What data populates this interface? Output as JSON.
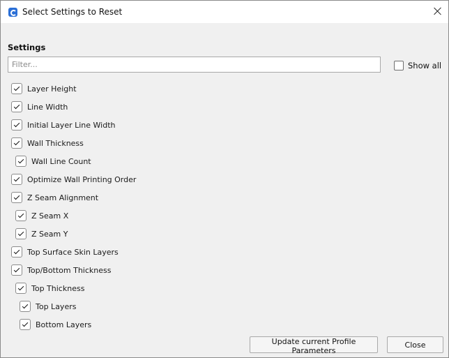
{
  "window": {
    "title": "Select Settings to Reset"
  },
  "settings_label": "Settings",
  "filter": {
    "placeholder": "Filter...",
    "value": ""
  },
  "show_all": {
    "label": "Show all",
    "checked": false
  },
  "settings": [
    {
      "label": "Layer Height",
      "checked": true
    },
    {
      "label": "Line Width",
      "checked": true
    },
    {
      "label": "Initial Layer Line Width",
      "checked": true
    },
    {
      "label": "Wall Thickness",
      "checked": true
    },
    {
      "label": "Wall Line Count",
      "checked": true
    },
    {
      "label": "Optimize Wall Printing Order",
      "checked": true
    },
    {
      "label": "Z Seam Alignment",
      "checked": true
    },
    {
      "label": "Z Seam X",
      "checked": true
    },
    {
      "label": "Z Seam Y",
      "checked": true
    },
    {
      "label": "Top Surface Skin Layers",
      "checked": true
    },
    {
      "label": "Top/Bottom Thickness",
      "checked": true
    },
    {
      "label": "Top Thickness",
      "checked": true
    },
    {
      "label": "Top Layers",
      "checked": true
    },
    {
      "label": "Bottom Layers",
      "checked": true
    }
  ],
  "buttons": {
    "update": "Update current Profile Parameters",
    "close": "Close"
  }
}
